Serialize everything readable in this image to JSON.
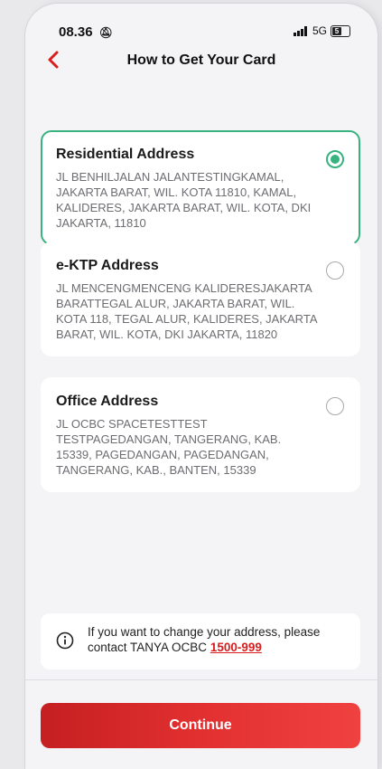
{
  "status_bar": {
    "time": "08.36",
    "network": "5G",
    "battery": "5"
  },
  "header": {
    "title": "How to Get Your Card"
  },
  "addresses": [
    {
      "title": "Residential Address",
      "address": "JL BENHILJALAN JALANTESTINGKAMAL, JAKARTA BARAT, WIL. KOTA 11810, KAMAL, KALIDERES, JAKARTA BARAT, WIL. KOTA, DKI JAKARTA, 11810",
      "selected": true
    },
    {
      "title": "e-KTP Address",
      "address": "JL MENCENGMENCENG KALIDERESJAKARTA BARATTEGAL ALUR, JAKARTA BARAT, WIL. KOTA 118, TEGAL ALUR, KALIDERES, JAKARTA BARAT, WIL. KOTA, DKI JAKARTA, 11820",
      "selected": false
    },
    {
      "title": "Office Address",
      "address": "JL OCBC SPACETESTTEST TESTPAGEDANGAN, TANGERANG, KAB. 15339, PAGEDANGAN, PAGEDANGAN, TANGERANG, KAB., BANTEN, 15339",
      "selected": false
    }
  ],
  "info": {
    "text": "If you want to change your address, please contact TANYA OCBC ",
    "phone": "1500-999"
  },
  "continue_label": "Continue",
  "colors": {
    "accent_red": "#d71f1f",
    "selected_green": "#36b37e"
  }
}
